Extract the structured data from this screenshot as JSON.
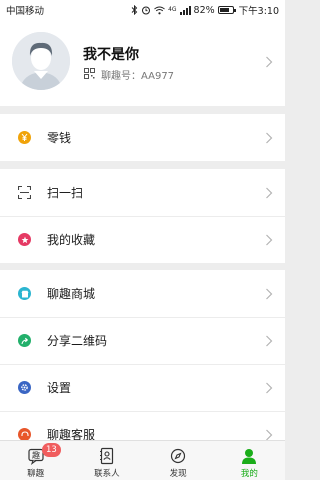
{
  "status_bar": {
    "carrier": "中国移动",
    "network": "4G",
    "battery": "82%",
    "battery_level": 0.82,
    "time": "下午3:10"
  },
  "profile": {
    "nickname": "我不是你",
    "account_label": "聊趣号：",
    "account_id": "AA977"
  },
  "menu": {
    "wallet": {
      "label": "零钱",
      "color": "#f0a30a",
      "icon": "yen-icon"
    },
    "scan": {
      "label": "扫一扫",
      "icon": "scan-icon"
    },
    "favorites": {
      "label": "我的收藏",
      "color": "#e53a64",
      "icon": "star-icon"
    },
    "store": {
      "label": "聊趣商城",
      "color": "#2bb5d0",
      "icon": "store-icon"
    },
    "share_qr": {
      "label": "分享二维码",
      "color": "#22b06b",
      "icon": "share-icon"
    },
    "settings": {
      "label": "设置",
      "color": "#3a66c4",
      "icon": "gear-icon"
    },
    "support": {
      "label": "聊趣客服",
      "color": "#e8562a",
      "icon": "support-icon"
    }
  },
  "tabs": [
    {
      "label": "聊趣",
      "badge": "13",
      "active": false
    },
    {
      "label": "联系人",
      "active": false
    },
    {
      "label": "发现",
      "active": false
    },
    {
      "label": "我的",
      "active": true
    }
  ],
  "colors": {
    "accent": "#1aad19",
    "background": "#ededed",
    "badge": "#f05d5e"
  }
}
